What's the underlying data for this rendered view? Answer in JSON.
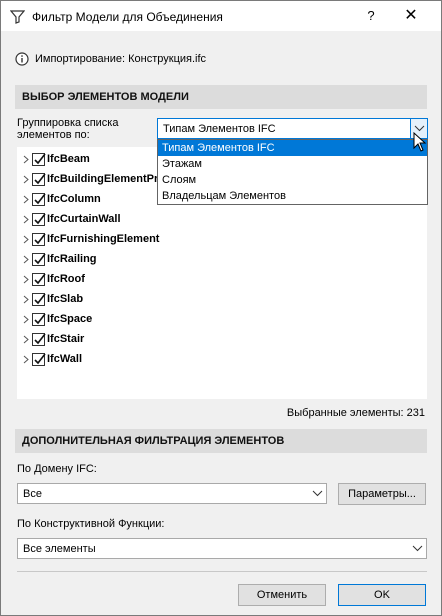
{
  "window": {
    "title": "Фильтр Модели для Объединения",
    "help": "?",
    "close": "✕"
  },
  "import": {
    "label": "Импортирование: Конструкция.ifc"
  },
  "section1": {
    "header": "ВЫБОР ЭЛЕМЕНТОВ МОДЕЛИ",
    "grouping_label": "Группировка списка элементов по:",
    "grouping_value": "Типам Элементов IFC",
    "dropdown_options": [
      "Типам Элементов IFC",
      "Этажам",
      "Слоям",
      "Владельцам Элементов"
    ],
    "dropdown_selected_index": 0,
    "tree_items": [
      {
        "label": "IfcBeam",
        "checked": true
      },
      {
        "label": "IfcBuildingElementProxy",
        "checked": true
      },
      {
        "label": "IfcColumn",
        "checked": true
      },
      {
        "label": "IfcCurtainWall",
        "checked": true
      },
      {
        "label": "IfcFurnishingElement",
        "checked": true
      },
      {
        "label": "IfcRailing",
        "checked": true
      },
      {
        "label": "IfcRoof",
        "checked": true
      },
      {
        "label": "IfcSlab",
        "checked": true
      },
      {
        "label": "IfcSpace",
        "checked": true
      },
      {
        "label": "IfcStair",
        "checked": true
      },
      {
        "label": "IfcWall",
        "checked": true
      }
    ],
    "selected_count": "Выбранные элементы: 231"
  },
  "section2": {
    "header": "ДОПОЛНИТЕЛЬНАЯ ФИЛЬТРАЦИЯ ЭЛЕМЕНТОВ",
    "domain_label": "По Домену IFC:",
    "domain_value": "Все",
    "params_button": "Параметры...",
    "function_label": "По Конструктивной Функции:",
    "function_value": "Все элементы"
  },
  "footer": {
    "cancel": "Отменить",
    "ok": "OK"
  },
  "colors": {
    "accent": "#0078d7",
    "section_bg": "#dcdcdc",
    "dialog_bg": "#f0f0f0"
  }
}
